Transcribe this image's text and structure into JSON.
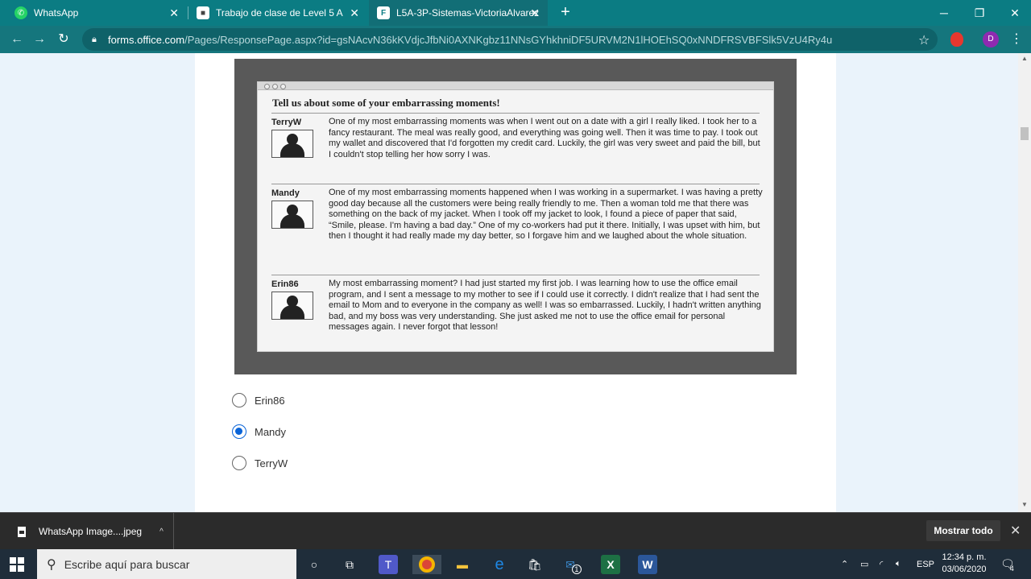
{
  "browser": {
    "tabs": [
      {
        "label": "WhatsApp",
        "icon": "whatsapp-icon",
        "active": false
      },
      {
        "label": "Trabajo de clase de Level 5 A",
        "icon": "classroom-icon",
        "active": false
      },
      {
        "label": "L5A-3P-Sistemas-VictoriaAlvarez",
        "icon": "forms-icon",
        "active": true
      }
    ],
    "url_host": "forms.office.com",
    "url_path": "/Pages/ResponsePage.aspx?id=gsNAcvN36kKVdjcJfbNi0AXNKgbz11NNsGYhkhniDF5URVM2N1lHOEhSQ0xNNDFRSVBFSlk5VzU4Ry4u",
    "profile_initial": "D"
  },
  "image": {
    "heading": "Tell us about some of your embarrassing moments!",
    "entries": [
      {
        "user": "TerryW",
        "text": "One of my most embarrassing moments was when I went out on a date with a girl I really liked. I took her to a fancy restaurant. The meal was really good, and everything was going well. Then it was time to pay. I took out my wallet and discovered that I'd forgotten my credit card. Luckily, the girl was very sweet and paid the bill, but I couldn't stop telling her how sorry I was."
      },
      {
        "user": "Mandy",
        "text": "One of my most embarrassing moments happened when I was working in a supermarket. I was having a pretty good day because all the customers were being really friendly to me. Then a woman told me that there was something on the back of my jacket. When I took off my jacket to look, I found a piece of paper that said, “Smile, please. I'm having a bad day.” One of my co-workers had put it there. Initially, I was upset with him, but then I thought it had really made my day better, so I forgave him and we laughed about the whole situation."
      },
      {
        "user": "Erin86",
        "text": "My most embarrassing moment? I had just started my first job. I was learning how to use the office email program, and I sent a message to my mother to see if I could use it correctly. I didn't realize that I had sent the email to Mom and to everyone in the company as well! I was so embarrassed. Luckily, I hadn't written anything bad, and my boss was very understanding. She just asked me not to use the office email for personal messages again. I never forgot that lesson!"
      }
    ]
  },
  "question": {
    "options": [
      {
        "label": "Erin86",
        "selected": false
      },
      {
        "label": "Mandy",
        "selected": true
      },
      {
        "label": "TerryW",
        "selected": false
      }
    ]
  },
  "downloads": {
    "file_label": "WhatsApp Image....jpeg",
    "show_all_label": "Mostrar todo"
  },
  "taskbar": {
    "search_placeholder": "Escribe aquí para buscar",
    "language": "ESP",
    "time": "12:34 p. m.",
    "date": "03/06/2020",
    "notification_count": "4",
    "mail_badge": "1"
  }
}
